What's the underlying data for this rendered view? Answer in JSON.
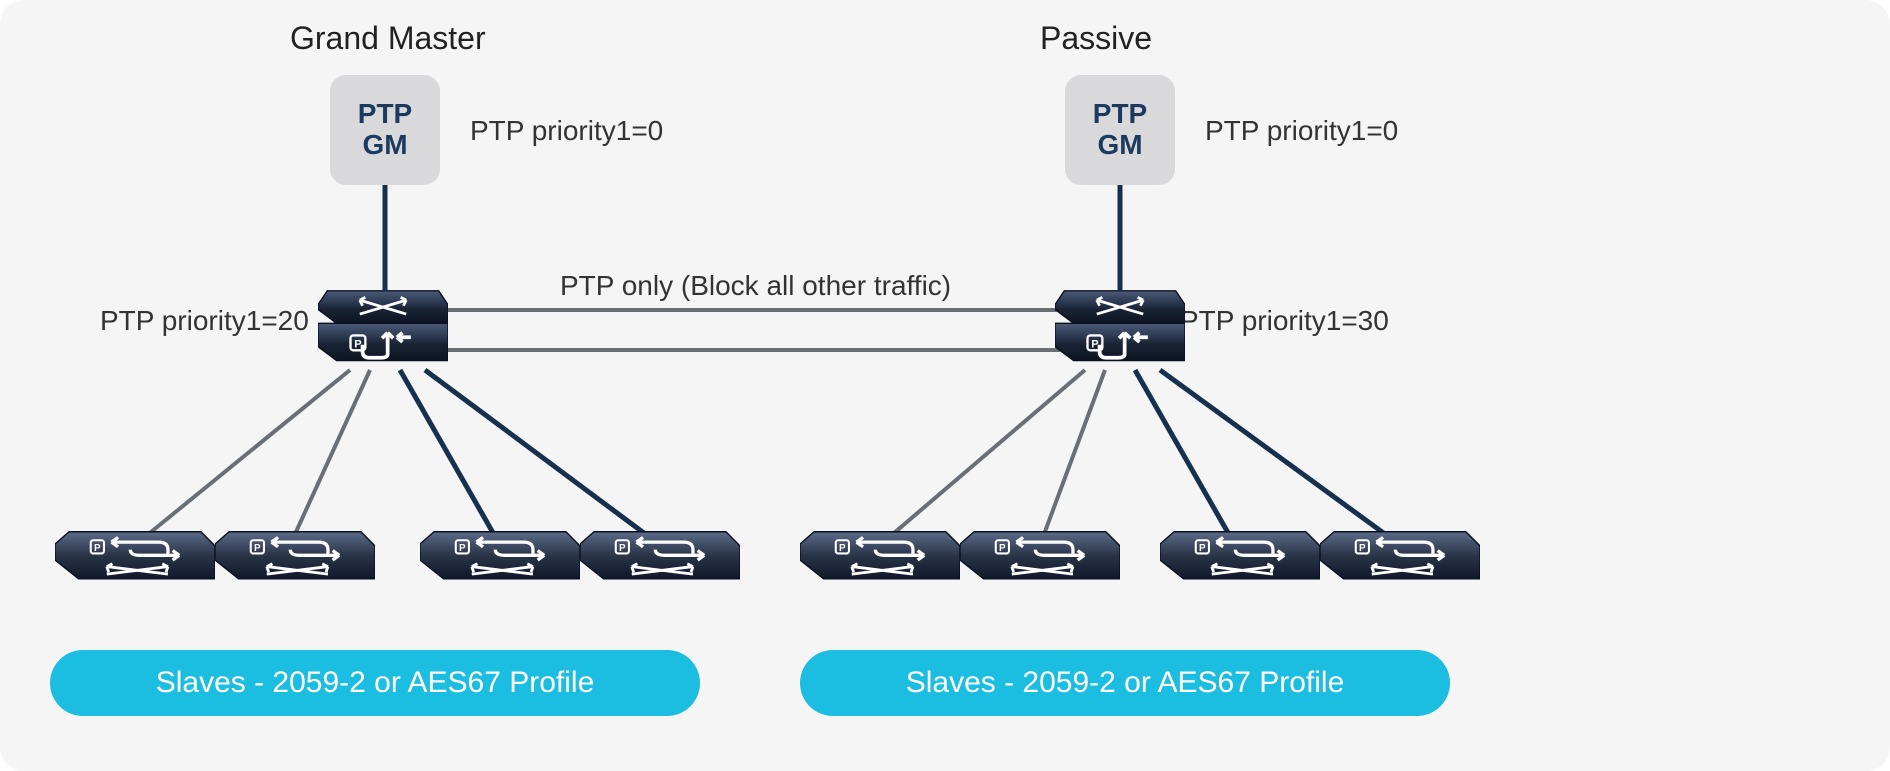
{
  "left": {
    "title": "Grand Master",
    "ptp_box_line1": "PTP",
    "ptp_box_line2": "GM",
    "gm_priority_label": "PTP priority1=0",
    "switch_priority_label": "PTP priority1=20",
    "slaves_label": "Slaves - 2059-2 or AES67 Profile"
  },
  "right": {
    "title": "Passive",
    "ptp_box_line1": "PTP",
    "ptp_box_line2": "GM",
    "gm_priority_label": "PTP priority1=0",
    "switch_priority_label": "PTP priority1=30",
    "slaves_label": "Slaves - 2059-2 or AES67 Profile"
  },
  "interconnect_label": "PTP only (Block all other traffic)"
}
